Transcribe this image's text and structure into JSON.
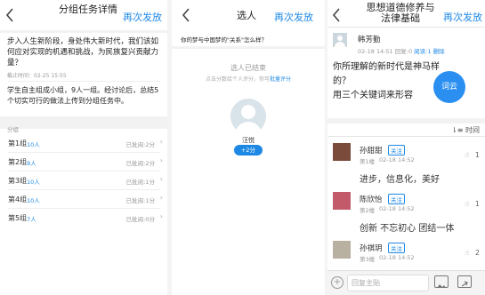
{
  "panel1": {
    "title": "分组任务详情",
    "action": "再次发放",
    "question": "步入人生新阶段，身处伟大新时代，我们该如何应对实现的机遇和挑战，为民族复兴贡献力量？",
    "deadline": "截止时间：02-25 15:55",
    "instruction": "学生自主组成小组，9人一组。经讨论后，总结5个切实可行的做法上传到分组任务中。",
    "group_header": "分组",
    "groups": [
      {
        "name": "第1组",
        "count": "10人",
        "status": "已批阅:2分"
      },
      {
        "name": "第2组",
        "count": "9人",
        "status": "已批阅:2分"
      },
      {
        "name": "第3组",
        "count": "10人",
        "status": "已批阅:1分"
      },
      {
        "name": "第4组",
        "count": "10人",
        "status": "已批阅:1分"
      },
      {
        "name": "第5组",
        "count": "7人",
        "status": "已批阅:0分"
      }
    ]
  },
  "panel2": {
    "title": "选人",
    "action": "再次发放",
    "question": "你的梦与中国梦的\"关系\"怎么样？",
    "ended": "选人已结束",
    "hint_prefix": "点击分数给个人评分，你可",
    "hint_link": "批量评分",
    "student_name": "汪悦",
    "score": "+2分"
  },
  "panel3": {
    "title": "思想道德修养与法律基础",
    "action": "再次发放",
    "post": {
      "author": "韩芳勤",
      "date": "02-18 14:51",
      "replies": "回复:0",
      "reads": "阅读:1",
      "delete": "删除",
      "body": "你所理解的新时代是神马样的？\n用三个关键词来形容"
    },
    "word_cloud": "词云",
    "sort_label": "时间",
    "follow_label": "关注",
    "replies": [
      {
        "name": "孙甜甜",
        "floor": "第1楼",
        "date": "02-18 14:52",
        "likes": "1",
        "text": "进步，信息化，美好"
      },
      {
        "name": "陈欣怡",
        "floor": "第2楼",
        "date": "02-18 14:52",
        "likes": "1",
        "text": "创新 不忘初心 团结一体"
      },
      {
        "name": "孙祺玥",
        "floor": "第3楼",
        "date": "02-18 14:52",
        "likes": "2",
        "text": ""
      }
    ],
    "reply_placeholder": "回复主贴"
  },
  "colors": {
    "accent": "#1e88e5",
    "word_cloud_bg": "#2a8ff0",
    "follow_tag": "#1e88e5"
  }
}
